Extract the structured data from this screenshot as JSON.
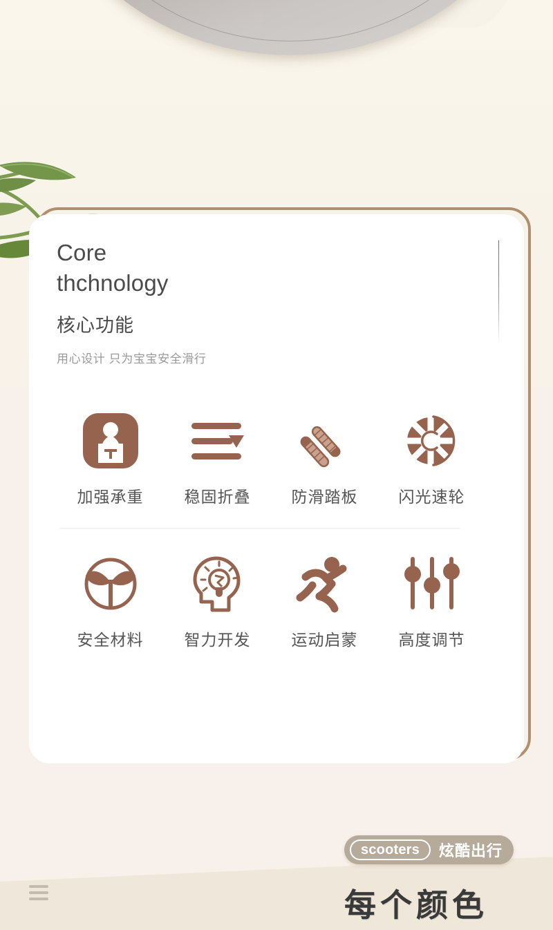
{
  "background": {
    "top_color": "#F7F2E8",
    "bottom_color": "#F8F0EA",
    "diagonal_color": "#EFE7D9",
    "plate_name": "grey-plate-prop",
    "plant_name": "green-plant-leaves"
  },
  "card": {
    "title_en": "Core\nthchnology",
    "title_cn": "核心功能",
    "subtitle": "用心设计 只为宝宝安全滑行",
    "border_color": "#B08E6E",
    "background": "#FFFFFF"
  },
  "features": {
    "icon_color": "#96634F",
    "label_color": "#555555",
    "row1": [
      {
        "icon": "weight-capacity-icon",
        "label": "加强承重"
      },
      {
        "icon": "fold-stable-icon",
        "label": "稳固折叠"
      },
      {
        "icon": "anti-slip-deck-icon",
        "label": "防滑踏板"
      },
      {
        "icon": "flash-wheel-icon",
        "label": "闪光速轮"
      }
    ],
    "row2": [
      {
        "icon": "safe-material-sprout-icon",
        "label": "安全材料"
      },
      {
        "icon": "intelligence-lightbulb-head-icon",
        "label": "智力开发"
      },
      {
        "icon": "running-person-icon",
        "label": "运动启蒙"
      },
      {
        "icon": "height-adjust-slider-icon",
        "label": "高度调节"
      }
    ]
  },
  "brand": {
    "name_en": "scooters",
    "name_cn": "炫酷出行",
    "pill_color": "#B6AA9B",
    "text_color": "#FFFFFF"
  },
  "headline": {
    "text": "每个颜色",
    "color": "#3A3A3A"
  },
  "corner": {
    "mark_name": "hamburger-mark",
    "color": "#C3BBB0"
  }
}
